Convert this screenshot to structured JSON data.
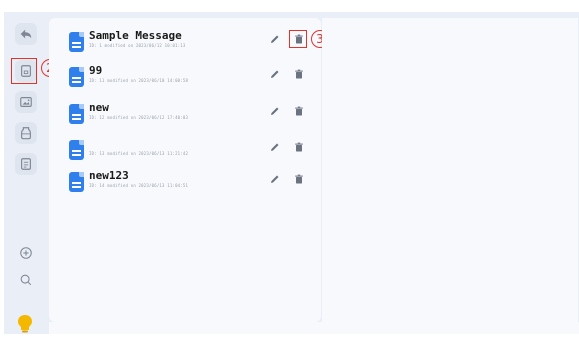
{
  "sidebar": {
    "icons": [
      {
        "name": "back-arrow-icon"
      },
      {
        "name": "text-document-icon"
      },
      {
        "name": "image-icon"
      },
      {
        "name": "bottle-icon"
      },
      {
        "name": "id-card-icon"
      },
      {
        "name": "add-circle-icon"
      },
      {
        "name": "search-icon"
      },
      {
        "name": "lightbulb-icon"
      }
    ]
  },
  "annotations": {
    "callout_2": "2",
    "callout_3": "3",
    "color": "#e0332d"
  },
  "messages": [
    {
      "title": "Sample Message",
      "meta": "ID: 1 modified on 2023/06/12 10:01:13"
    },
    {
      "title": "99",
      "meta": "ID: 11 modified on 2023/06/10 14:00:58"
    },
    {
      "title": "new",
      "meta": "ID: 12 modified on 2023/06/12 17:40:03"
    },
    {
      "title": "",
      "meta": "ID: 13 modified on 2023/06/13 11:21:42"
    },
    {
      "title": "new123",
      "meta": "ID: 14 modified on 2023/06/13 11:04:51"
    }
  ],
  "colors": {
    "accent": "#2f80ed",
    "background": "#e9eef7",
    "panel": "#f7f9fc"
  }
}
